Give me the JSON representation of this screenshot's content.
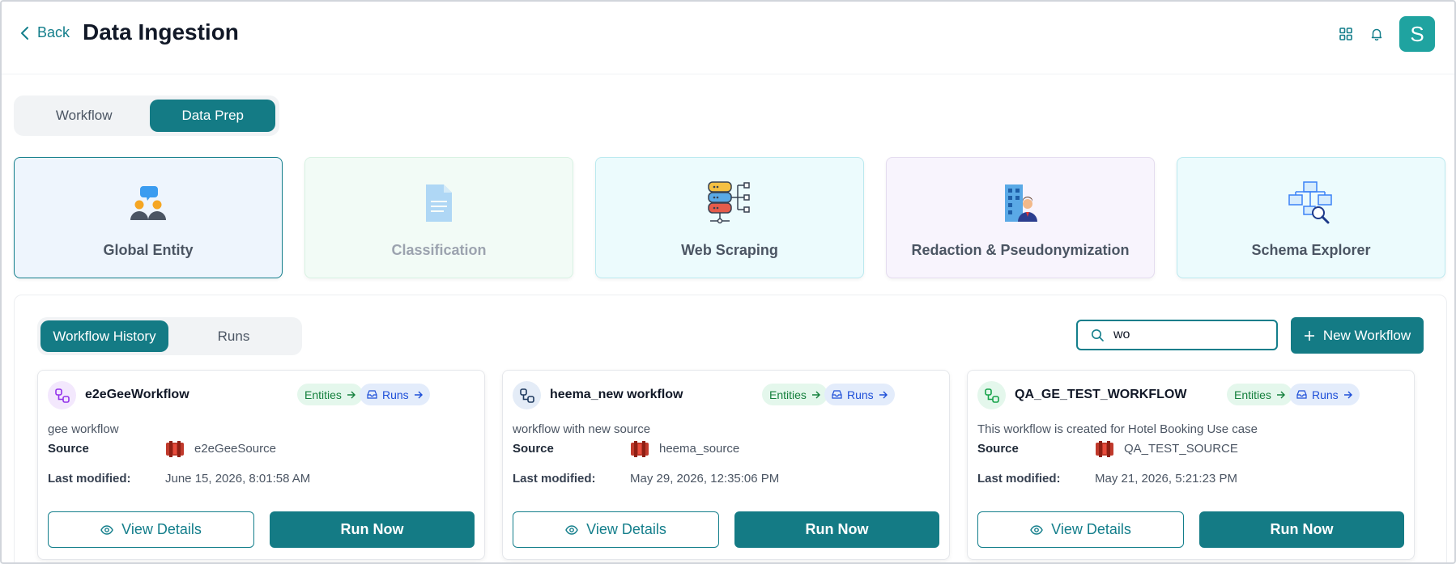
{
  "header": {
    "back_label": "Back",
    "title": "Data Ingestion",
    "avatar_initial": "S"
  },
  "top_tabs": [
    {
      "label": "Workflow",
      "active": false
    },
    {
      "label": "Data Prep",
      "active": true
    }
  ],
  "features": [
    {
      "label": "Global Entity",
      "icon": "users-chat-icon"
    },
    {
      "label": "Classification",
      "icon": "document-icon"
    },
    {
      "label": "Web Scraping",
      "icon": "database-tree-icon"
    },
    {
      "label": "Redaction & Pseudonymization",
      "icon": "building-person-icon"
    },
    {
      "label": "Schema Explorer",
      "icon": "schema-search-icon"
    }
  ],
  "workflow_panel": {
    "tabs": [
      {
        "label": "Workflow History",
        "active": true
      },
      {
        "label": "Runs",
        "active": false
      }
    ],
    "search_value": "wo",
    "new_workflow_label": "New Workflow"
  },
  "labels": {
    "entities": "Entities",
    "runs": "Runs",
    "source": "Source",
    "last_modified": "Last modified:",
    "view_details": "View Details",
    "run_now": "Run Now"
  },
  "workflows": [
    {
      "name": "e2eGeeWorkflow",
      "description": "gee workflow",
      "source": "e2eGeeSource",
      "last_modified": "June 15, 2026, 8:01:58 AM",
      "icon_bg": "#f3e8fd",
      "icon_color": "#9333ea"
    },
    {
      "name": "heema_new workflow",
      "description": "workflow with new source",
      "source": "heema_source",
      "last_modified": "May 29, 2026, 12:35:06 PM",
      "icon_bg": "#e4ecf7",
      "icon_color": "#1e3a5f"
    },
    {
      "name": "QA_GE_TEST_WORKFLOW",
      "description": "This workflow is created for Hotel Booking Use case",
      "source": "QA_TEST_SOURCE",
      "last_modified": "May 21, 2026, 5:21:23 PM",
      "icon_bg": "#e4f7ec",
      "icon_color": "#16a34a"
    }
  ],
  "colors": {
    "primary": "#147b85",
    "accent": "#1fa3a0"
  }
}
